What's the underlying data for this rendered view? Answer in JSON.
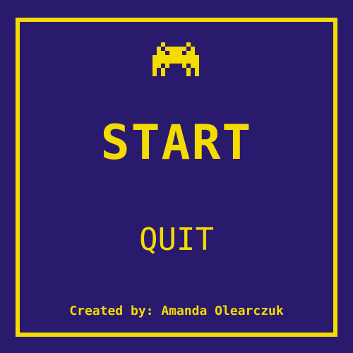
{
  "menu": {
    "start_label": "START",
    "quit_label": "QUIT"
  },
  "credits": {
    "text": "Created by: Amanda Olearczuk"
  },
  "icons": {
    "logo": "space-invader-icon"
  },
  "colors": {
    "background": "#2a1a6e",
    "accent": "#f5dc00"
  }
}
